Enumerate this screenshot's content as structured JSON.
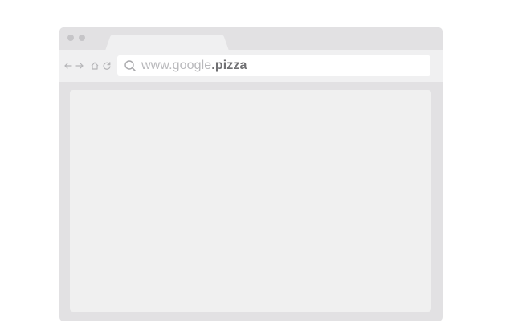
{
  "browser": {
    "window_dots": [
      "dot",
      "dot"
    ],
    "toolbar": {
      "back_icon": "arrow-left-icon",
      "forward_icon": "arrow-right-icon",
      "home_icon": "home-icon",
      "reload_icon": "reload-icon"
    },
    "address_bar": {
      "search_icon": "search-icon",
      "url_domain": "www.google",
      "url_tld": ".pizza"
    }
  },
  "colors": {
    "frame": "#e2e1e3",
    "toolbar": "#f0f0f1",
    "content": "#f0f0f0",
    "url_muted": "#b9b9bc",
    "url_emphasis": "#707073"
  }
}
